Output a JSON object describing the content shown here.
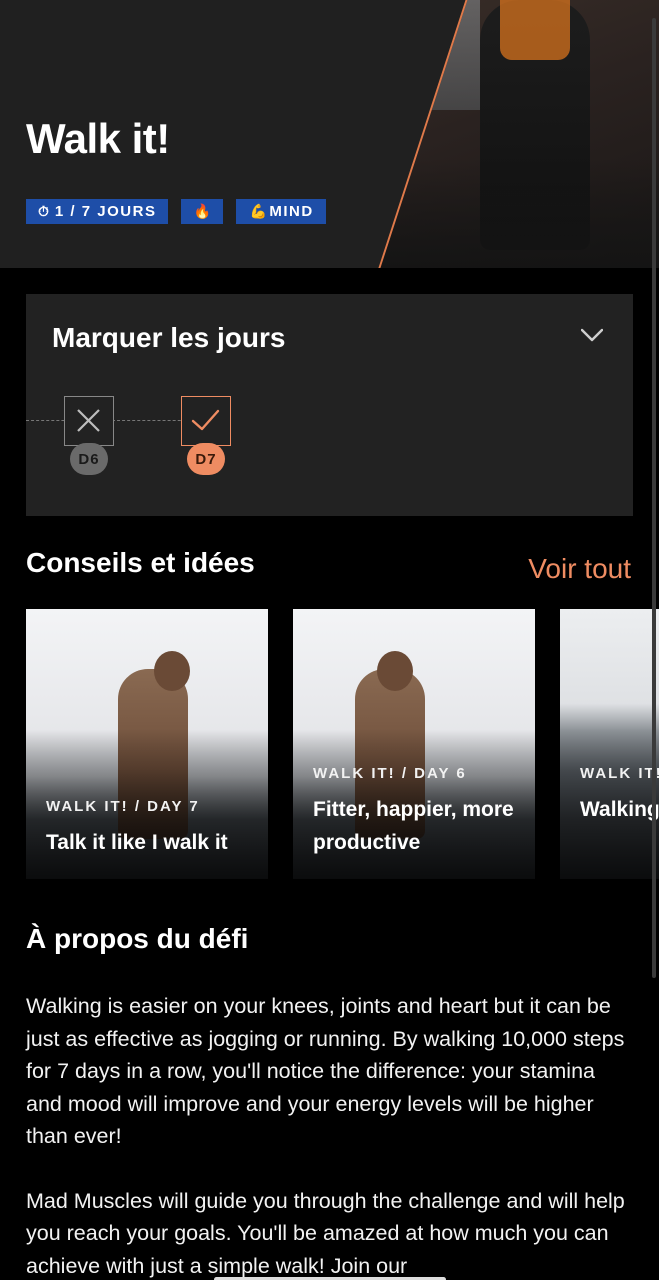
{
  "hero": {
    "title": "Walk it!",
    "tags": [
      {
        "icon": "stopwatch-icon",
        "glyph": "⏱",
        "label": "1 / 7 JOURS"
      },
      {
        "icon": "fire-icon",
        "glyph": "🔥",
        "label": ""
      },
      {
        "icon": "flexed-biceps-icon",
        "glyph": "💪",
        "label": "MIND"
      }
    ]
  },
  "mark_days": {
    "title": "Marquer les jours",
    "days": [
      {
        "label": "D6",
        "status": "missed"
      },
      {
        "label": "D7",
        "status": "done"
      }
    ]
  },
  "tips": {
    "title": "Conseils et idées",
    "see_all": "Voir tout",
    "cards": [
      {
        "kicker": "WALK IT! / DAY 7",
        "title": "Talk it like I walk it"
      },
      {
        "kicker": "WALK IT! / DAY 6",
        "title": "Fitter, happier, more productive"
      },
      {
        "kicker": "WALK IT!",
        "title": "Walking viruses"
      }
    ]
  },
  "about": {
    "title": "À propos du défi",
    "paragraphs": [
      "Walking is easier on your knees, joints and heart but it can be just as effective as jogging or running. By walking 10,000 steps for 7 days in a row, you'll notice the difference: your stamina and mood will improve and your energy levels will be higher than ever!",
      "Mad Muscles will guide you through the challenge and will help you reach your goals. You'll be amazed at how much you can achieve with just a simple walk! Join our"
    ]
  },
  "colors": {
    "accent": "#ef8c62",
    "tag_bg": "#1e4ea8",
    "card_bg": "#222222"
  }
}
